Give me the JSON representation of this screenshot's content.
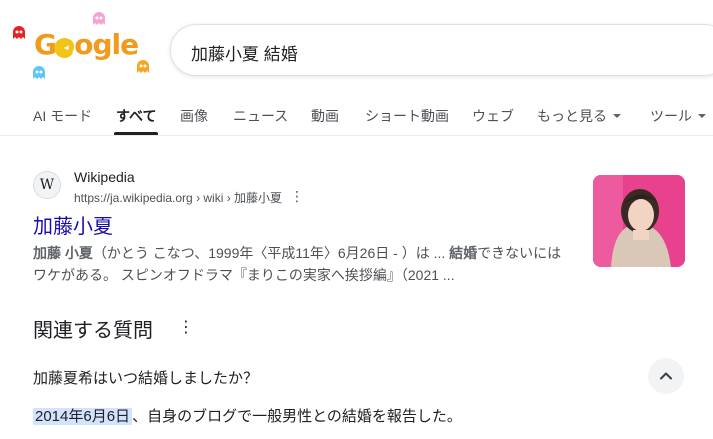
{
  "logo": {
    "text_parts": [
      "G",
      "o",
      "ogle"
    ]
  },
  "search": {
    "query": "加藤小夏 結婚"
  },
  "tabs": [
    {
      "label": "AI モード"
    },
    {
      "label": "すべて"
    },
    {
      "label": "画像"
    },
    {
      "label": "ニュース"
    },
    {
      "label": "動画"
    },
    {
      "label": "ショート動画"
    },
    {
      "label": "ウェブ"
    },
    {
      "label": "もっと見る"
    },
    {
      "label": "ツール"
    }
  ],
  "result": {
    "favicon": "W",
    "site_name": "Wikipedia",
    "url": "https://ja.wikipedia.org › wiki › 加藤小夏",
    "menu": "⋮",
    "title": "加藤小夏",
    "snippet_bold": "加藤 小夏",
    "snippet_line1": "（かとう こなつ、1999年〈平成11年〉6月26日 - ）は ... ",
    "snippet_bold2": "結婚",
    "snippet_line1b": "できないには",
    "snippet_line2": "ワケがある。 スピンオフドラマ『まりこの実家へ挨拶編』（2021 ..."
  },
  "paa": {
    "title": "関連する質問",
    "menu": "⋮",
    "question": "加藤夏希はいつ結婚しましたか？",
    "answer_highlight": "2014年6月6日",
    "answer_rest": "、自身のブログで一般男性との結婚を報告した。"
  },
  "colors": {
    "link": "#1a0dab",
    "highlight": "#d3e3fd",
    "logo_orange": "#f29a1b"
  }
}
